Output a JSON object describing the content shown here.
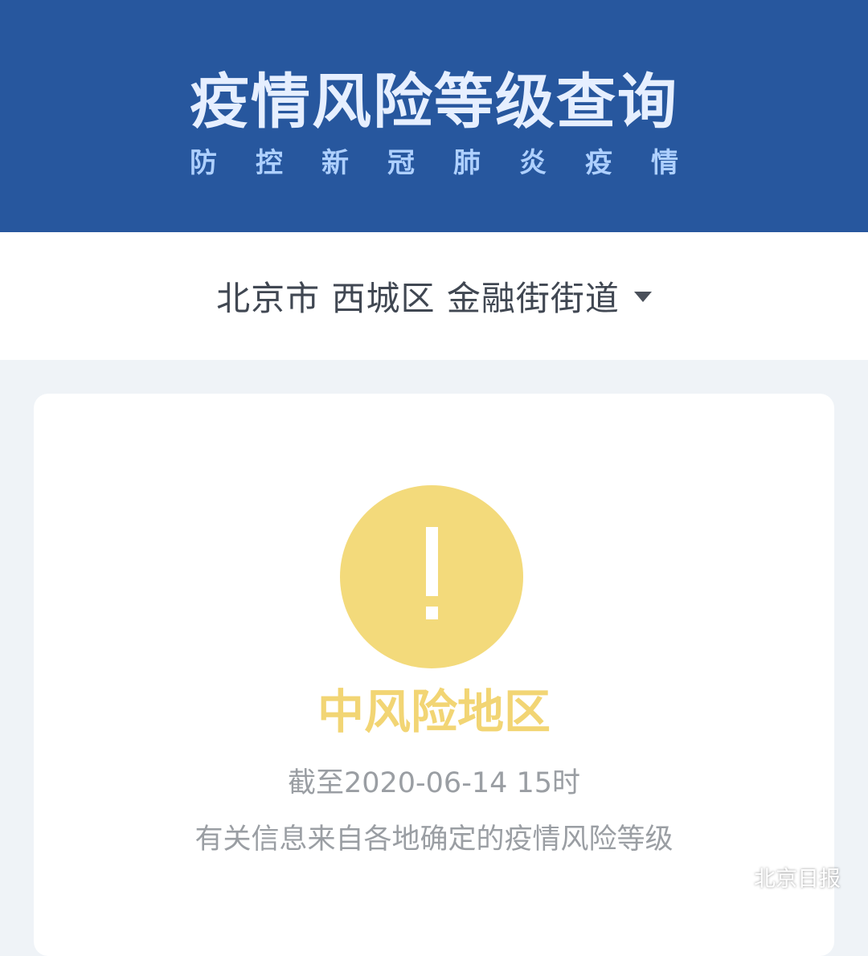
{
  "header": {
    "title": "疫情风险等级查询",
    "subtitle_chars": [
      "防",
      "控",
      "新",
      "冠",
      "肺",
      "炎",
      "疫",
      "情"
    ]
  },
  "location": {
    "label": "北京市 西城区 金融街街道",
    "dropdown_icon": "caret-down-icon"
  },
  "result": {
    "icon": "exclamation-icon",
    "icon_color": "#f3da7b",
    "risk_level": "中风险地区",
    "updated": "截至2020-06-14 15时",
    "info": "有关信息来自各地确定的疫情风险等级"
  },
  "watermark": {
    "icon": "wechat-icon",
    "text": "北京日报"
  },
  "colors": {
    "header_bg": "#27579e",
    "page_bg": "#eff3f7",
    "risk_text": "#f2d574"
  }
}
